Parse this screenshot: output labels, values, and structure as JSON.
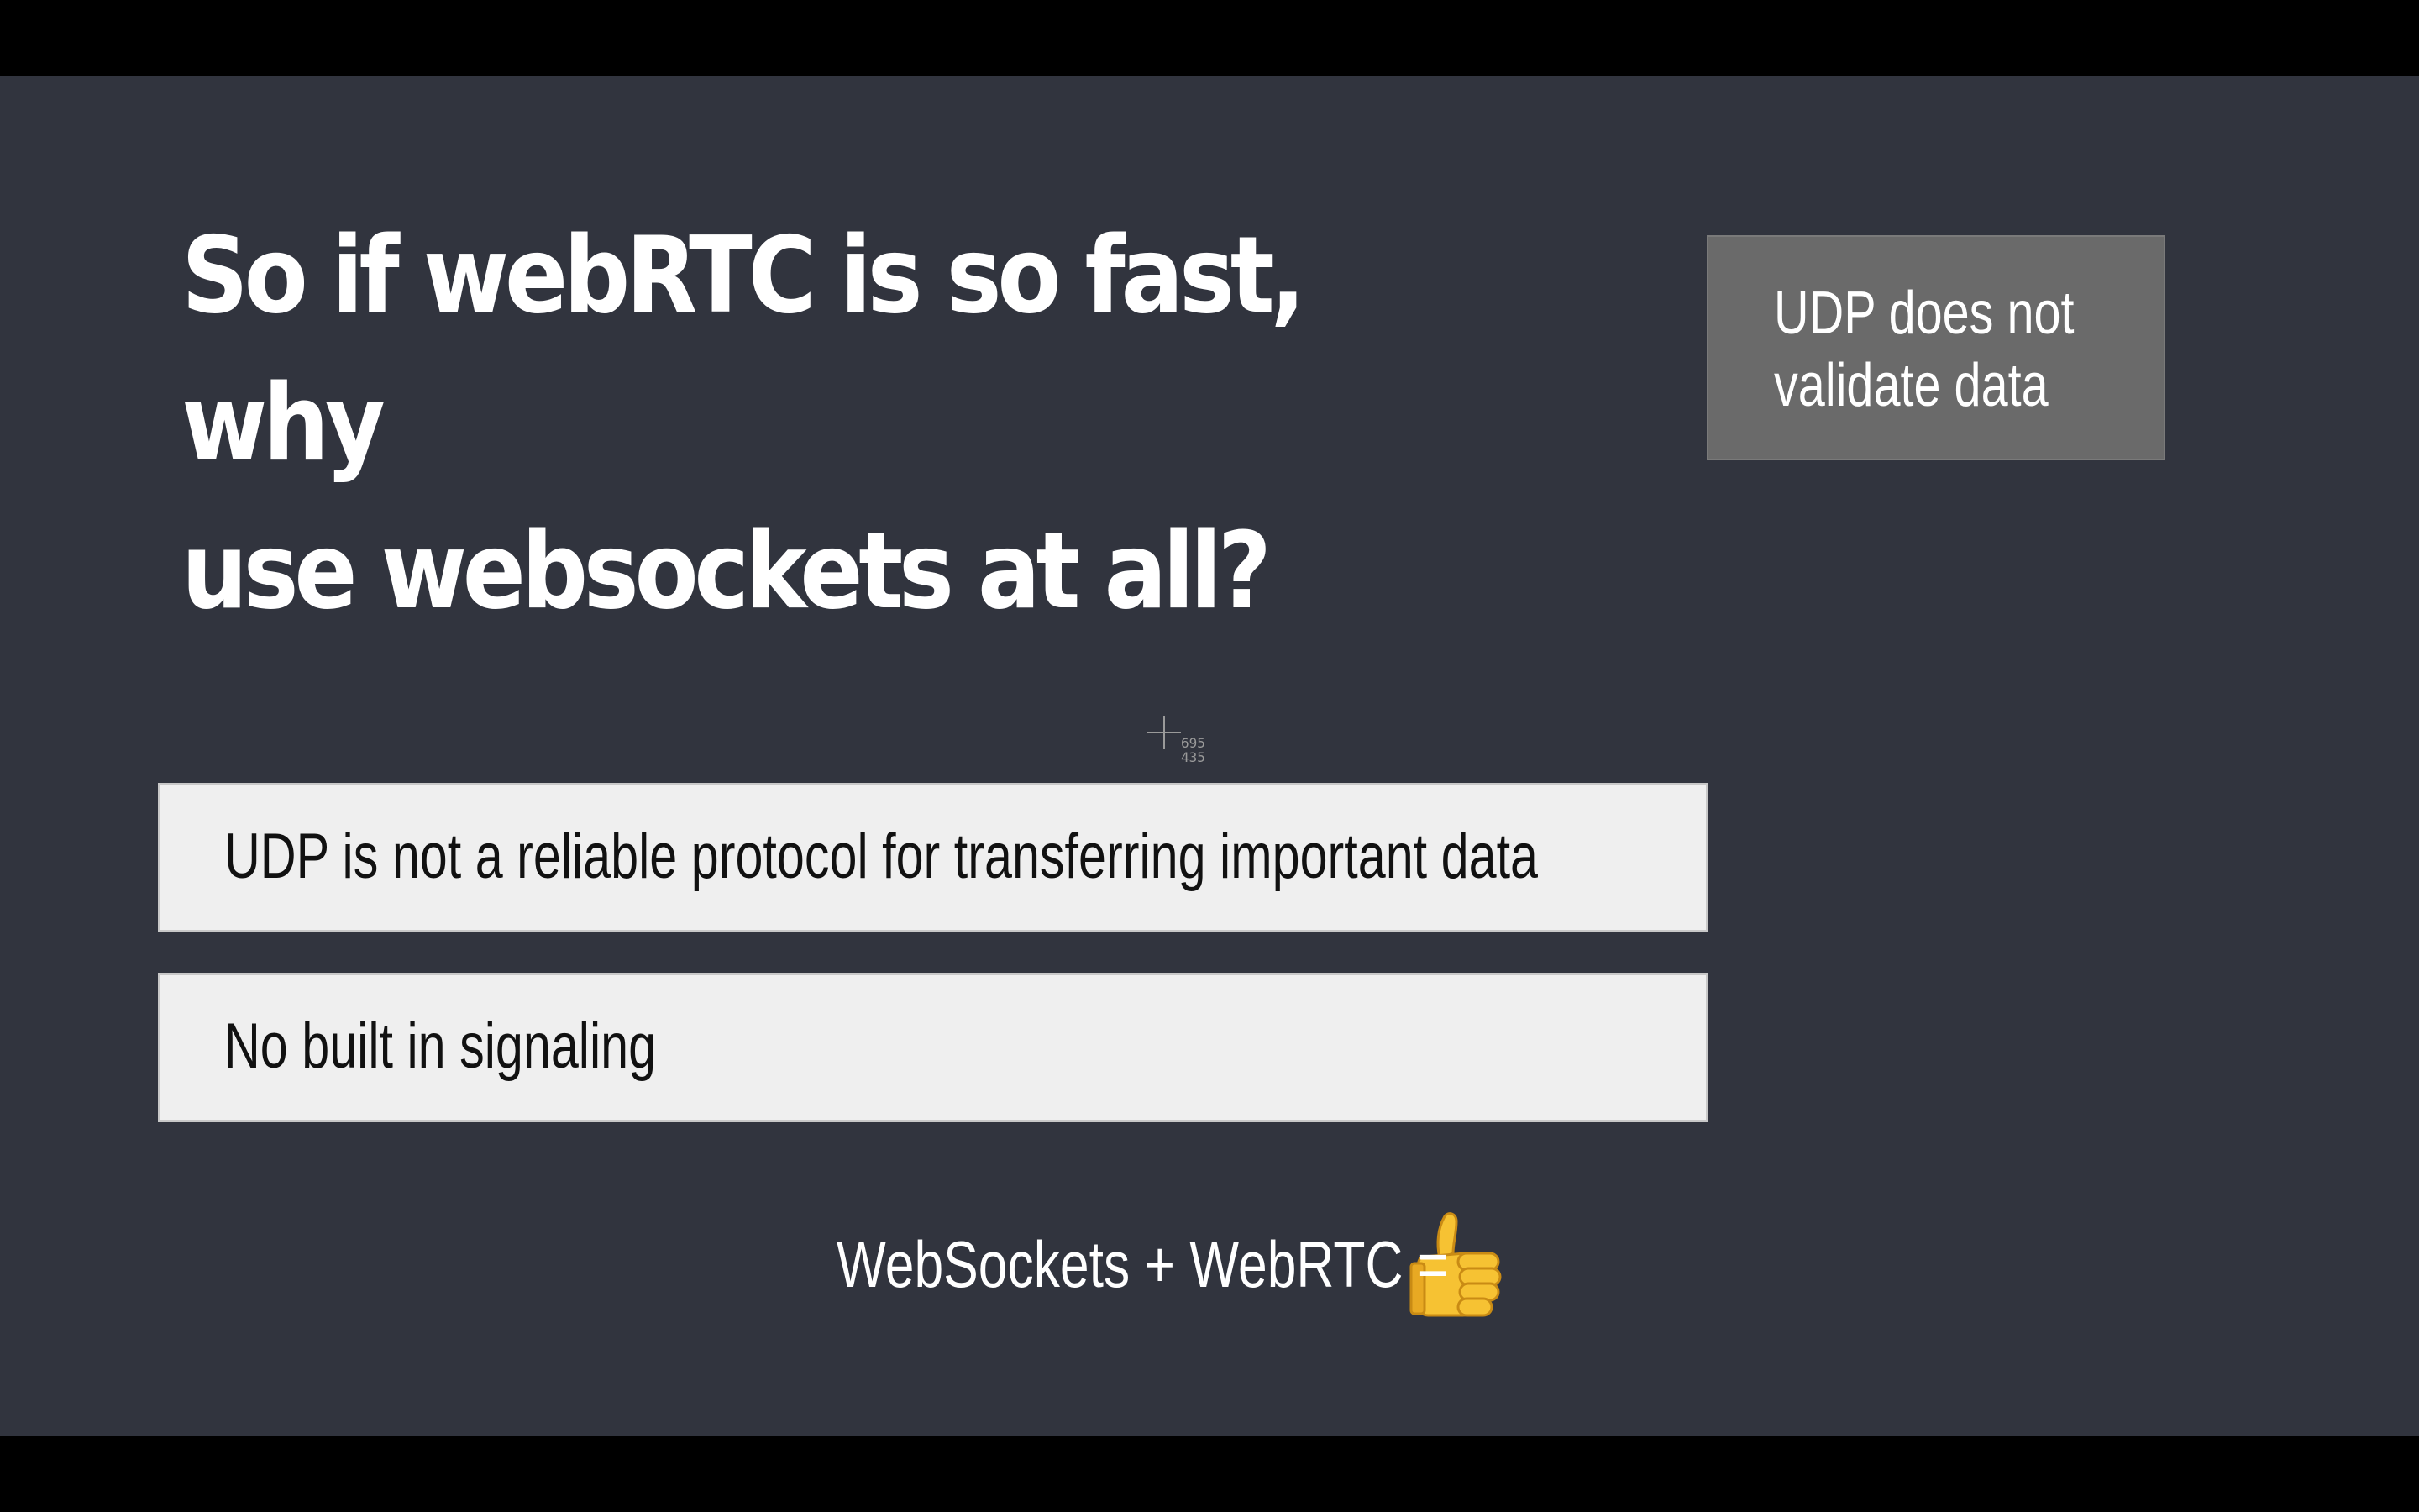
{
  "slide": {
    "title_line1": "So if webRTC is so fast, why",
    "title_line2": "use websockets at all?",
    "callout": {
      "line1": "UDP does not",
      "line2": "validate data"
    },
    "bullets": [
      "UDP is not a reliable protocol for transferring important data",
      "No built in signaling"
    ],
    "formula": "WebSockets + WebRTC =",
    "formula_icon": "thumbs-up-icon"
  },
  "cursor": {
    "readout_x": "695",
    "readout_y": "435"
  },
  "colors": {
    "background": "#31343e",
    "letterbox": "#000000",
    "callout_fill": "#6a6a6a",
    "bullet_fill": "#efefef",
    "title_text": "#ffffff",
    "thumb_yellow": "#f6c233"
  }
}
